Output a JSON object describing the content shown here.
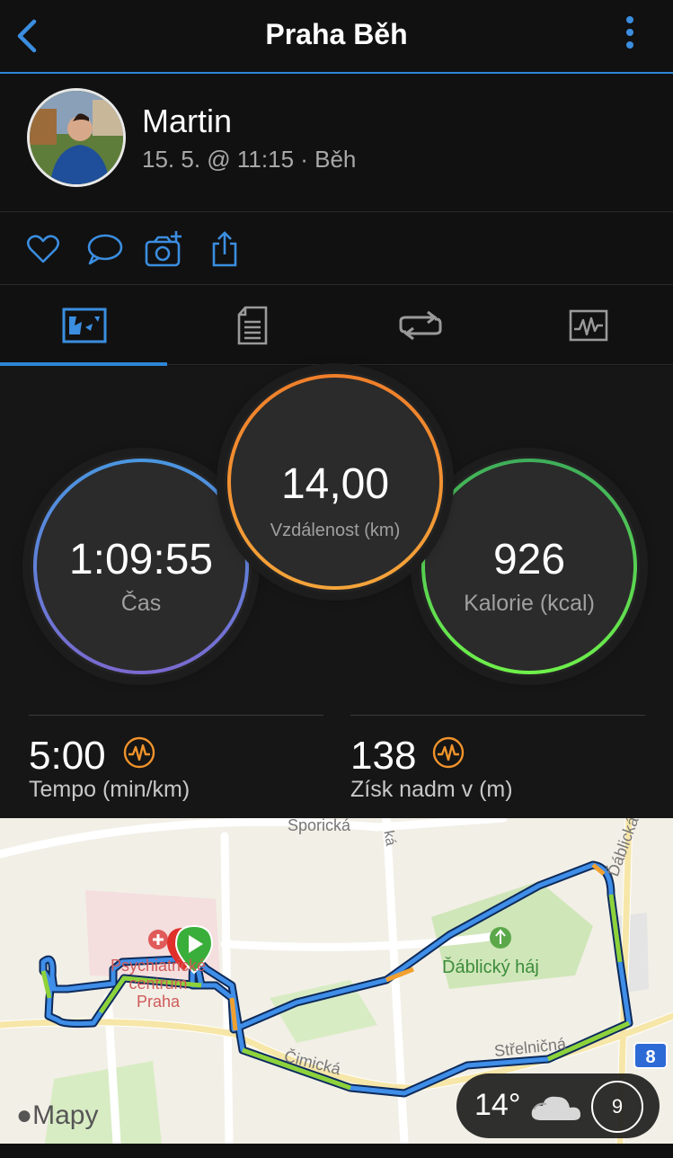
{
  "header": {
    "title": "Praha Běh",
    "back_icon": "chevron-left-icon",
    "menu_icon": "more-vertical-icon",
    "accent_color": "#2e86d6"
  },
  "user": {
    "name": "Martin",
    "meta": "15. 5. @ 11:15 · Běh"
  },
  "actions": [
    "heart-icon",
    "comment-icon",
    "add-photo-icon",
    "share-icon"
  ],
  "tabs": [
    "overview-icon",
    "details-icon",
    "laps-icon",
    "charts-icon"
  ],
  "stats": {
    "time": {
      "value": "1:09:55",
      "label": "Čas",
      "color": "#5a8ee0"
    },
    "distance": {
      "value": "14,00",
      "label": "Vzdálenost (km)",
      "color": "#f0932b"
    },
    "calories": {
      "value": "926",
      "label": "Kalorie (kcal)",
      "color": "#4cd964"
    },
    "pace": {
      "value": "5:00",
      "label": "Tempo (min/km)"
    },
    "elevation": {
      "value": "138",
      "label": "Získ nadm v (m)"
    }
  },
  "map": {
    "labels": {
      "street_top": "Sporická",
      "street_top2": "ká",
      "street_right": "Ďáblická",
      "forest": "Ďáblický háj",
      "hospital1": "Psychiatrické",
      "hospital2": "centrum",
      "hospital3": "Praha",
      "street_bottom": "Čimická",
      "street_bottom2": "Střelničná",
      "road_badge": "8"
    },
    "attribution": "Mapy",
    "weather": {
      "temp": "14°",
      "icon": "cloud-icon",
      "wind": "9"
    }
  }
}
